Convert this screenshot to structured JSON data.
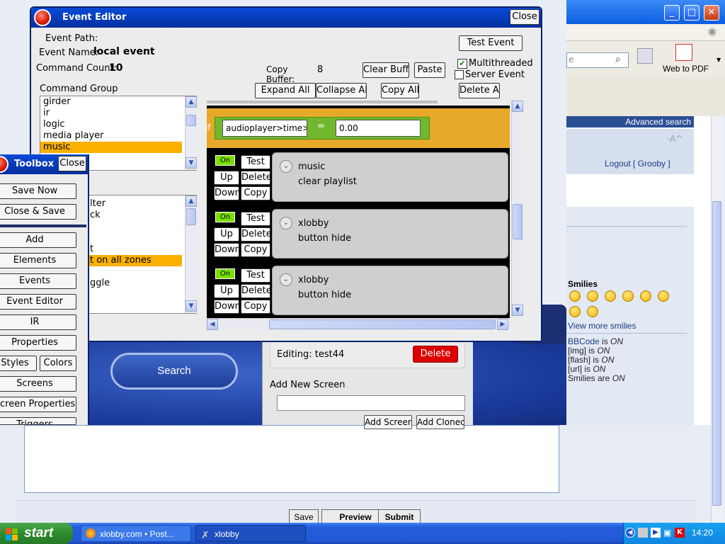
{
  "browser": {
    "search_placeholder": "e",
    "web_to_pdf": "Web to PDF",
    "advanced_search": "Advanced search",
    "aa_toggle": "-A^",
    "logout_label": "Logout [ Grooby ]",
    "smilies_heading": "Smilies",
    "view_more_smilies": "View more smilies",
    "bbcode_label": "BBCode",
    "bbcode_is": " is ",
    "bbcode_value": "ON",
    "img_label": "[img] is ",
    "img_value": "ON",
    "flash_label": "[flash] is ",
    "flash_value": "ON",
    "url_label": "[url] is ",
    "url_value": "ON",
    "smilies_are_label": "Smilies are ",
    "smilies_are_value": "ON",
    "save_button": "Save",
    "preview_button": "Preview",
    "submit_button": "Submit"
  },
  "xlobby_app": {
    "search_button": "Search",
    "editing_label": "Editing: test44",
    "delete_button": "Delete",
    "add_new_screen_label": "Add New Screen",
    "add_screen_button": "Add Screer",
    "add_cloned_button": "Add Clonec"
  },
  "event_editor": {
    "title": "Event Editor",
    "close": "Close",
    "event_path_label": "Event Path:",
    "event_name_label": "Event Name:",
    "event_name_value": "local event",
    "command_count_label": "Command Count:",
    "command_count_value": "10",
    "test_event": "Test Event",
    "copy_buffer_label": "Copy Buffer:",
    "copy_buffer_value": "8",
    "clear_buffer": "Clear Buffe",
    "paste": "Paste",
    "multithreaded": "Multithreaded",
    "server_event": "Server Event",
    "expand_all": "Expand All",
    "collapse_all": "Collapse All",
    "copy_all": "Copy All",
    "delete_all": "Delete Al",
    "command_group_label": "Command Group",
    "command_groups": [
      "girder",
      "ir",
      "logic",
      "media player",
      "music"
    ],
    "command_group_selected": "music",
    "commands_visible": [
      "lter",
      "ck",
      "",
      "",
      "t",
      "t on all zones",
      "",
      "ggle"
    ],
    "if_label": "if",
    "condition_left": "audioplayer>time>",
    "condition_op": "=",
    "condition_right": "0.00",
    "commands": [
      {
        "on": "On",
        "test": "Test",
        "up": "Up",
        "delete": "Delete",
        "down": "Down",
        "copy": "Copy",
        "group": "music",
        "action": "clear playlist"
      },
      {
        "on": "On",
        "test": "Test",
        "up": "Up",
        "delete": "Delete",
        "down": "Down",
        "copy": "Copy",
        "group": "xlobby",
        "action": "button hide"
      },
      {
        "on": "On",
        "test": "Test",
        "up": "Up",
        "delete": "Delete",
        "down": "Down",
        "copy": "Copy",
        "group": "xlobby",
        "action": "button hide"
      }
    ]
  },
  "toolbox": {
    "title": "Toolbox",
    "close": "Close",
    "buttons": [
      "Save Now",
      "Close & Save",
      "Add",
      "Elements",
      "Events",
      "Event Editor",
      "IR",
      "Properties",
      "Styles",
      "Colors",
      "Screens",
      "Screen Properties",
      "Triggers"
    ]
  },
  "taskbar": {
    "start": "start",
    "tasks": [
      "xlobby.com • Post...",
      "xlobby"
    ],
    "clock": "14:20"
  }
}
